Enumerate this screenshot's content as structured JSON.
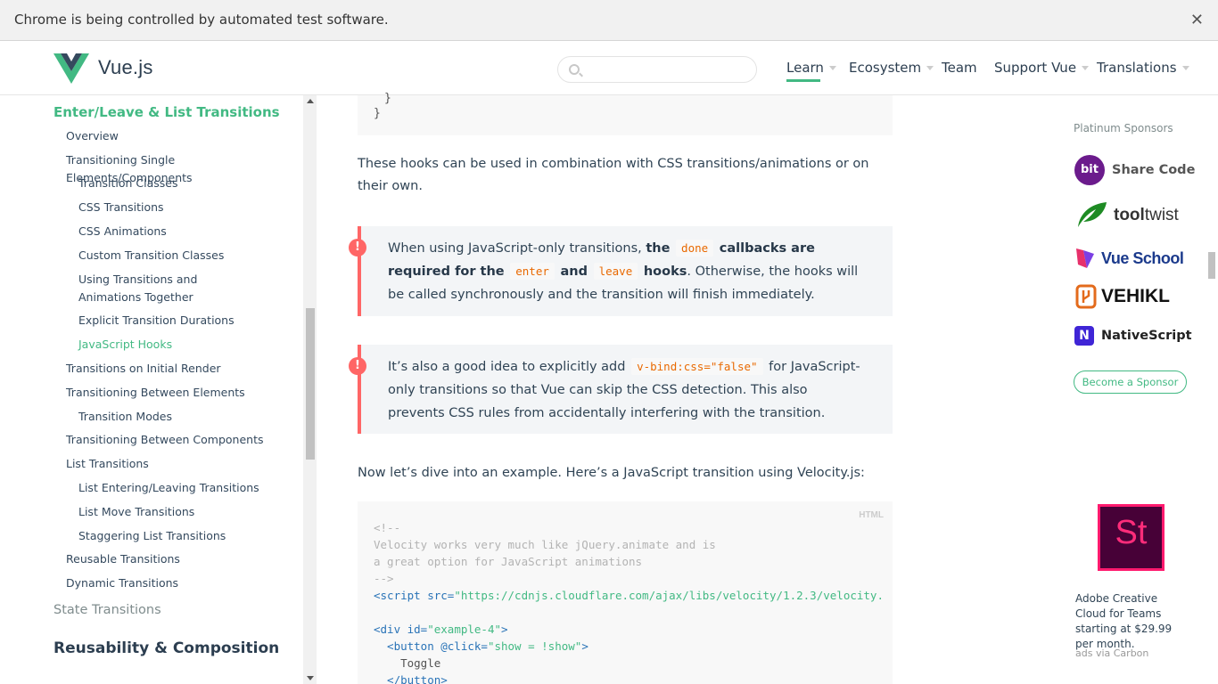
{
  "infobar": {
    "text": "Chrome is being controlled by automated test software.",
    "close_icon": "close-icon"
  },
  "header": {
    "logo_text": "Vue.js",
    "search_placeholder": "",
    "nav": {
      "learn": "Learn",
      "ecosystem": "Ecosystem",
      "team": "Team",
      "support": "Support Vue",
      "translations": "Translations"
    }
  },
  "sidebar": {
    "section_title": "Enter/Leave & List Transitions",
    "items": [
      "Overview",
      "Transitioning Single Elements/Components",
      "Transition Classes",
      "CSS Transitions",
      "CSS Animations",
      "Custom Transition Classes",
      "Using Transitions and Animations Together",
      "Explicit Transition Durations",
      "JavaScript Hooks",
      "Transitions on Initial Render",
      "Transitioning Between Elements",
      "Transition Modes",
      "Transitioning Between Components",
      "List Transitions",
      "List Entering/Leaving Transitions",
      "List Move Transitions",
      "Staggering List Transitions",
      "Reusable Transitions",
      "Dynamic Transitions"
    ],
    "state_transitions": "State Transitions",
    "reusability": "Reusability & Composition"
  },
  "content": {
    "code_top": [
      "}",
      "}"
    ],
    "para1": "These hooks can be used in combination with CSS transitions/animations or on their own.",
    "tip1": {
      "a": "When using JavaScript-only transitions, ",
      "b_the": "the",
      "code_done": "done",
      "b_callbacks": "callbacks are required for the",
      "code_enter": "enter",
      "b_and": "and",
      "code_leave": "leave",
      "b_hooks": "hooks",
      "rest": ". Otherwise, the hooks will be called synchronously and the transition will finish immediately."
    },
    "tip2": {
      "a": "It’s also a good idea to explicitly add ",
      "code": "v-bind:css=\"false\"",
      "rest": " for JavaScript-only transitions so that Vue can skip the CSS detection. This also prevents CSS rules from accidentally interfering with the transition."
    },
    "para2": "Now let’s dive into an example. Here’s a JavaScript transition using Velocity.js:",
    "code_lang": "HTML",
    "code": {
      "c1": "<!--",
      "c2": "Velocity works very much like jQuery.animate and is",
      "c3": "a great option for JavaScript animations",
      "c4": "-->",
      "script_open": "<script",
      "src_attr": " src=",
      "src_val": "\"https://cdnjs.cloudflare.com/ajax/libs/velocity/1.2.3/velocity.",
      "div_open": "<div",
      "id_attr": " id=",
      "id_val": "\"example-4\"",
      "div_close": ">",
      "button_open": "  <button",
      "click_attr": " @click=",
      "click_val": "\"show = !show\"",
      "button_gt": ">",
      "toggle": "    Toggle",
      "button_close": "  </button>"
    }
  },
  "sponsors": {
    "title": "Platinum Sponsors",
    "bit_logo": "bit",
    "bit": "Share Code",
    "tooltwist_a": "tool",
    "tooltwist_b": "twist",
    "vueschool": "Vue School",
    "vehikl": "VEHIKL",
    "ns_logo": "N",
    "nativescript": "NativeScript",
    "become": "Become a Sponsor"
  },
  "carbon": {
    "logo": "St",
    "text": "Adobe Creative Cloud for Teams starting at $29.99 per month.",
    "via": "ads via Carbon"
  }
}
